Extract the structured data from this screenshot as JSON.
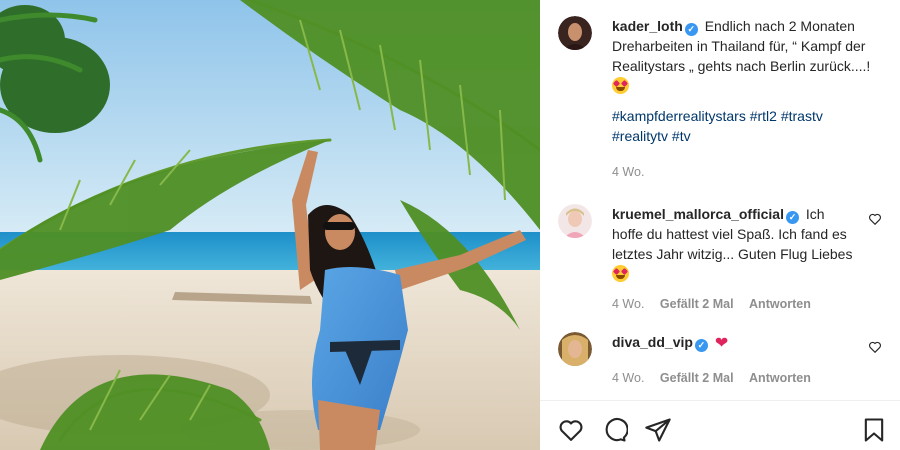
{
  "post": {
    "author": "kader_loth",
    "caption": "Endlich nach 2 Monaten Dreharbeiten in Thailand für, “ Kampf der Realitystars „ gehts nach Berlin zurück....!",
    "hashtags": [
      "#kampfderrealitystars",
      "#rtl2",
      "#trastv",
      "#realitytv",
      "#tv"
    ],
    "time": "4 Wo."
  },
  "comments": [
    {
      "author": "kruemel_mallorca_official",
      "text": "Ich hoffe du hattest viel Spaß. Ich fand es letztes Jahr witzig... Guten Flug Liebes",
      "time": "4 Wo.",
      "likes": "Gefällt 2 Mal",
      "reply": "Antworten"
    },
    {
      "author": "diva_dd_vip",
      "text": "",
      "time": "4 Wo.",
      "likes": "Gefällt 2 Mal",
      "reply": "Antworten"
    }
  ],
  "icons": {
    "like": "heart-icon",
    "comment": "comment-icon",
    "share": "share-icon",
    "save": "bookmark-icon",
    "verified": "verified-badge-icon"
  },
  "colors": {
    "verified": "#3897f0",
    "hashtag": "#00376b",
    "meta": "#8e8e8e"
  }
}
